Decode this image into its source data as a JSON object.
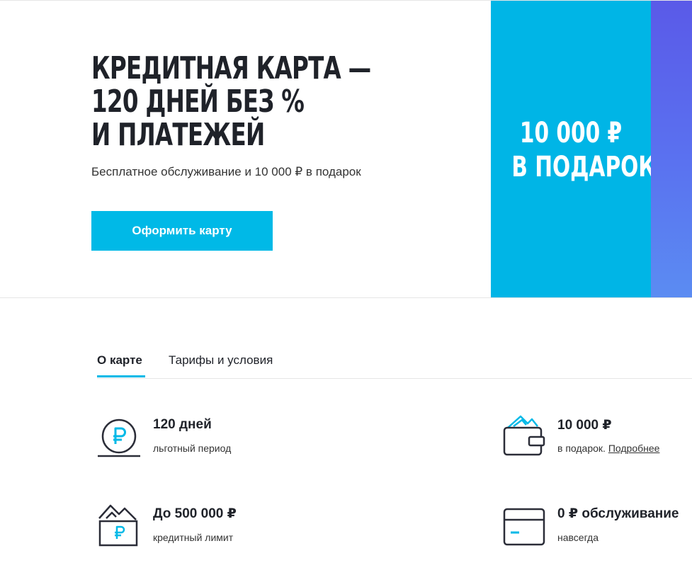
{
  "hero": {
    "title_lines": [
      "КРЕДИТНАЯ КАРТА —",
      "120 ДНЕЙ БЕЗ %",
      "И ПЛАТЕЖЕЙ"
    ],
    "subtitle": "Бесплатное обслуживание и 10 000 ₽ в подарок",
    "cta_label": "Оформить карту"
  },
  "promo": {
    "line1": "10 000 ₽",
    "line2": "В ПОДАРОК"
  },
  "tabs": [
    {
      "label": "О карте",
      "active": true
    },
    {
      "label": "Тарифы и условия",
      "active": false
    }
  ],
  "features": [
    {
      "title": "120 дней",
      "subtitle": "льготный период",
      "icon": "ruble-coin-icon"
    },
    {
      "title": "10 000 ₽",
      "subtitle": "в подарок.",
      "link": "Подробнее",
      "icon": "wallet-icon"
    },
    {
      "title": "До 500 000 ₽",
      "subtitle": "кредитный лимит",
      "icon": "cash-envelope-icon"
    },
    {
      "title": "0 ₽ обслуживание",
      "subtitle": "навсегда",
      "icon": "card-icon"
    }
  ],
  "colors": {
    "accent": "#00b9e7",
    "promo": "#00b5e6",
    "promo_edge": "#5a6cec",
    "text": "#1f2229"
  }
}
